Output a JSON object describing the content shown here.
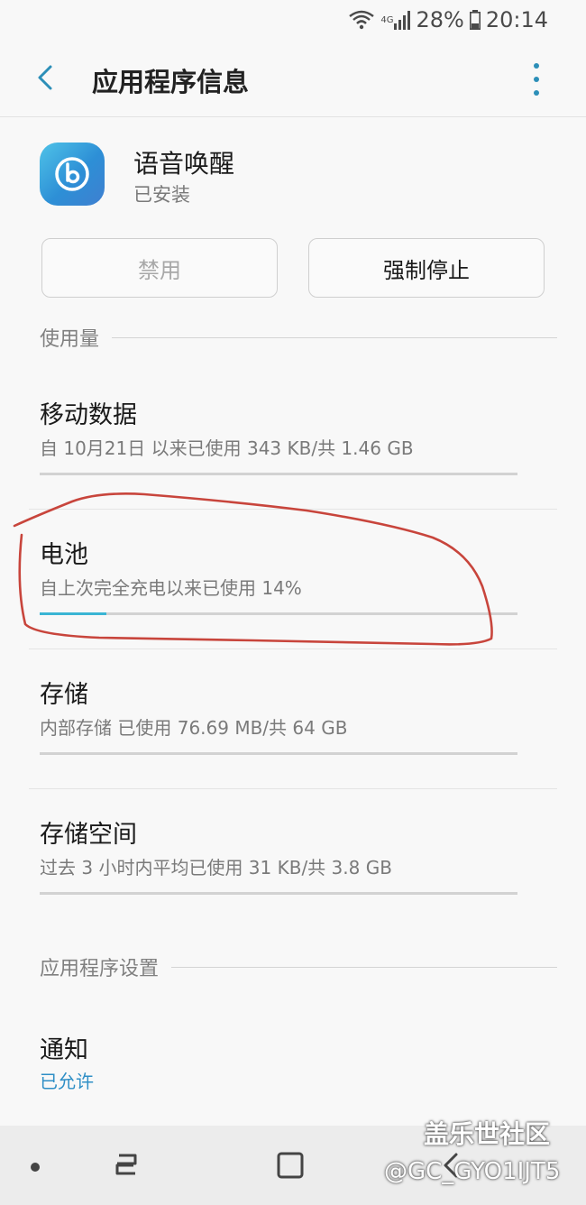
{
  "status_bar": {
    "network": "4G",
    "battery_percent": "28%",
    "time": "20:14"
  },
  "header": {
    "title": "应用程序信息"
  },
  "app": {
    "name": "语音唤醒",
    "state": "已安装"
  },
  "buttons": {
    "disable": "禁用",
    "force_stop": "强制停止"
  },
  "usage_section": {
    "title": "使用量",
    "items": [
      {
        "title": "移动数据",
        "subtitle": "自 10月21日 以来已使用 343 KB/共 1.46 GB",
        "progress": 0.0
      },
      {
        "title": "电池",
        "subtitle": "自上次完全充电以来已使用 14%",
        "progress": 0.14
      },
      {
        "title": "存储",
        "subtitle": "内部存储 已使用 76.69 MB/共 64 GB",
        "progress": 0.0
      },
      {
        "title": "存储空间",
        "subtitle": "过去 3 小时内平均已使用 31 KB/共 3.8 GB",
        "progress": 0.0
      }
    ]
  },
  "settings_section": {
    "title": "应用程序设置",
    "items": [
      {
        "title": "通知",
        "subtitle": "已允许"
      }
    ]
  },
  "watermark": {
    "line1": "盖乐世社区",
    "line2": "@GC_GYO1IJT5"
  },
  "colors": {
    "accent": "#3ab5d4",
    "link": "#2f8fc6",
    "annotation": "#c8453c"
  }
}
